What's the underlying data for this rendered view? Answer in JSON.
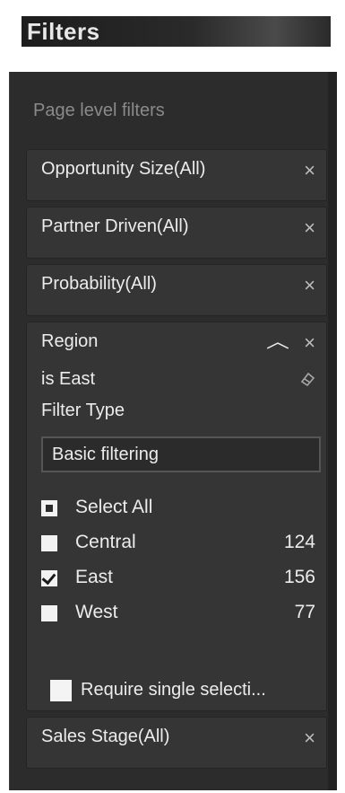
{
  "header": {
    "title": "Filters"
  },
  "pane": {
    "section_title": "Page level filters",
    "cards": [
      {
        "label": "Opportunity Size(All)",
        "close": "×"
      },
      {
        "label": "Partner Driven(All)",
        "close": "×"
      },
      {
        "label": "Probability(All)",
        "close": "×"
      }
    ],
    "region": {
      "label": "Region",
      "close": "×",
      "collapse": "︿",
      "condition": "is East",
      "filter_type_label": "Filter Type",
      "filter_type_value": "Basic filtering",
      "options": [
        {
          "label": "Select All",
          "count": "",
          "state": "partial"
        },
        {
          "label": "Central",
          "count": "124",
          "state": "unchecked"
        },
        {
          "label": "East",
          "count": "156",
          "state": "checked"
        },
        {
          "label": "West",
          "count": "77",
          "state": "unchecked"
        }
      ],
      "require_single": "Require single selecti..."
    },
    "last_card": {
      "label": "Sales Stage(All)",
      "close": "×"
    }
  }
}
